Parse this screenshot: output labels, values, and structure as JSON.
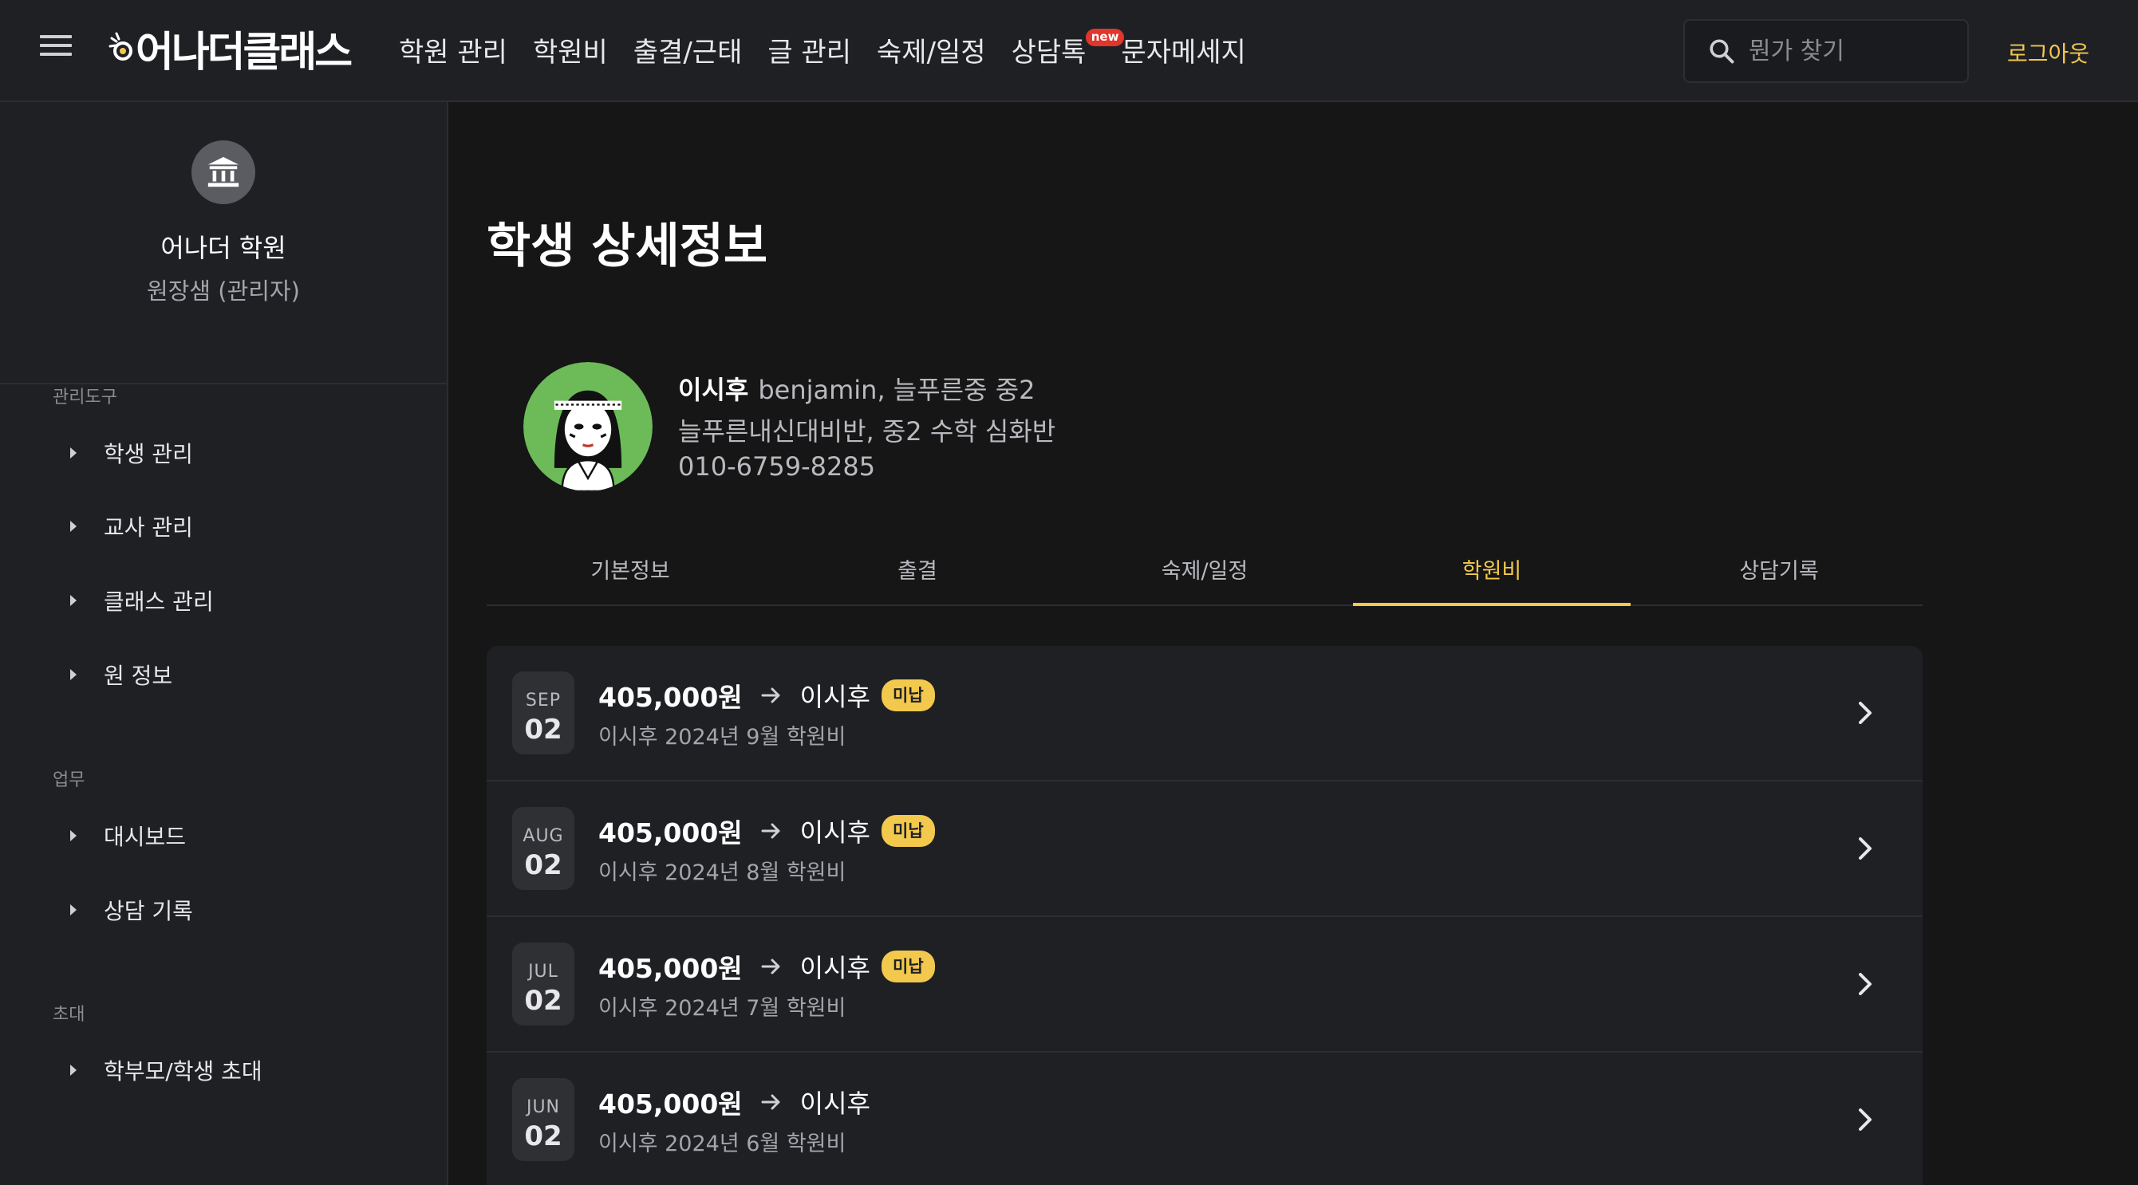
{
  "header": {
    "logo_text": "어나더클래스",
    "nav": [
      "학원 관리",
      "학원비",
      "출결/근태",
      "글 관리",
      "숙제/일정",
      "상담톡",
      "문자메세지"
    ],
    "new_badge": "new",
    "search_placeholder": "뭔가 찾기",
    "logout": "로그아웃"
  },
  "sidebar": {
    "academy_name": "어나더 학원",
    "role": "원장샘 (관리자)",
    "sections": [
      {
        "title": "관리도구",
        "items": [
          "학생 관리",
          "교사 관리",
          "클래스 관리",
          "원 정보"
        ]
      },
      {
        "title": "업무",
        "items": [
          "대시보드",
          "상담 기록"
        ]
      },
      {
        "title": "초대",
        "items": [
          "학부모/학생 초대"
        ]
      }
    ]
  },
  "main": {
    "title": "학생 상세정보",
    "student": {
      "name": "이시후",
      "info": "benjamin, 늘푸른중 중2",
      "classes": "늘푸른내신대비반, 중2 수학 심화반",
      "phone": "010-6759-8285"
    },
    "tabs": [
      "기본정보",
      "출결",
      "숙제/일정",
      "학원비",
      "상담기록"
    ],
    "active_tab": "학원비",
    "fees": [
      {
        "month": "SEP",
        "day": "02",
        "amount": "405,000원",
        "payer": "이시후",
        "status": "미납",
        "desc": "이시후 2024년 9월 학원비"
      },
      {
        "month": "AUG",
        "day": "02",
        "amount": "405,000원",
        "payer": "이시후",
        "status": "미납",
        "desc": "이시후 2024년 8월 학원비"
      },
      {
        "month": "JUL",
        "day": "02",
        "amount": "405,000원",
        "payer": "이시후",
        "status": "미납",
        "desc": "이시후 2024년 7월 학원비"
      },
      {
        "month": "JUN",
        "day": "02",
        "amount": "405,000원",
        "payer": "이시후",
        "status": "",
        "desc": "이시후 2024년 6월 학원비"
      }
    ]
  },
  "colors": {
    "accent": "#f2c94c",
    "badge_red": "#e0362b",
    "avatar_green": "#6dbb58"
  }
}
